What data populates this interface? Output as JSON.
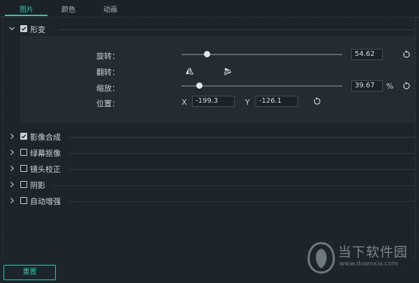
{
  "tabs": [
    {
      "label": "图片",
      "active": true
    },
    {
      "label": "颜色",
      "active": false
    },
    {
      "label": "动画",
      "active": false
    }
  ],
  "transform": {
    "label": "形变",
    "checked": true,
    "expanded": true,
    "rotate": {
      "label": "旋转：",
      "value": "54.62",
      "level": 0.155
    },
    "flip": {
      "label": "翻转："
    },
    "scale": {
      "label": "缩放：",
      "value": "39.67",
      "unit": "%",
      "level": 0.11
    },
    "position": {
      "label": "位置：",
      "x_label": "X",
      "x_value": "-199.3",
      "y_label": "Y",
      "y_value": "-126.1"
    }
  },
  "sections": [
    {
      "label": "影像合成",
      "checked": true
    },
    {
      "label": "绿幕抠像",
      "checked": false
    },
    {
      "label": "镜头校正",
      "checked": false
    },
    {
      "label": "阴影",
      "checked": false
    },
    {
      "label": "自动增强",
      "checked": false
    }
  ],
  "footer": {
    "reset_label": "重置"
  },
  "watermark": {
    "name": "当下软件园",
    "url": "www.downxia.com"
  },
  "colors": {
    "accent": "#34c6a8",
    "background": "#1d252c",
    "panel": "#232c33"
  }
}
